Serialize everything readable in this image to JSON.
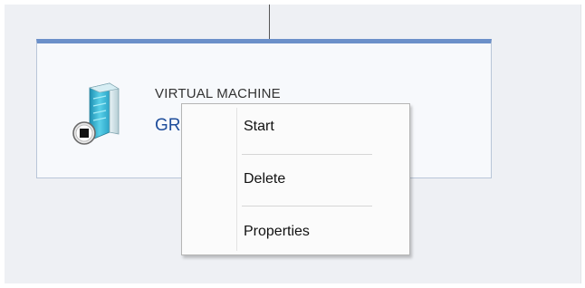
{
  "diagram": {
    "vm_card": {
      "type_label": "VIRTUAL MACHINE",
      "name": "GR",
      "icon": "server-icon",
      "status_icon": "stopped-status-icon"
    },
    "context_menu": {
      "items": [
        {
          "label": "Start"
        },
        {
          "label": "Delete"
        },
        {
          "label": "Properties"
        }
      ]
    }
  },
  "colors": {
    "card_accent": "#6b90c9",
    "name_link": "#1f4e9c",
    "canvas_background": "#eef0f4"
  }
}
